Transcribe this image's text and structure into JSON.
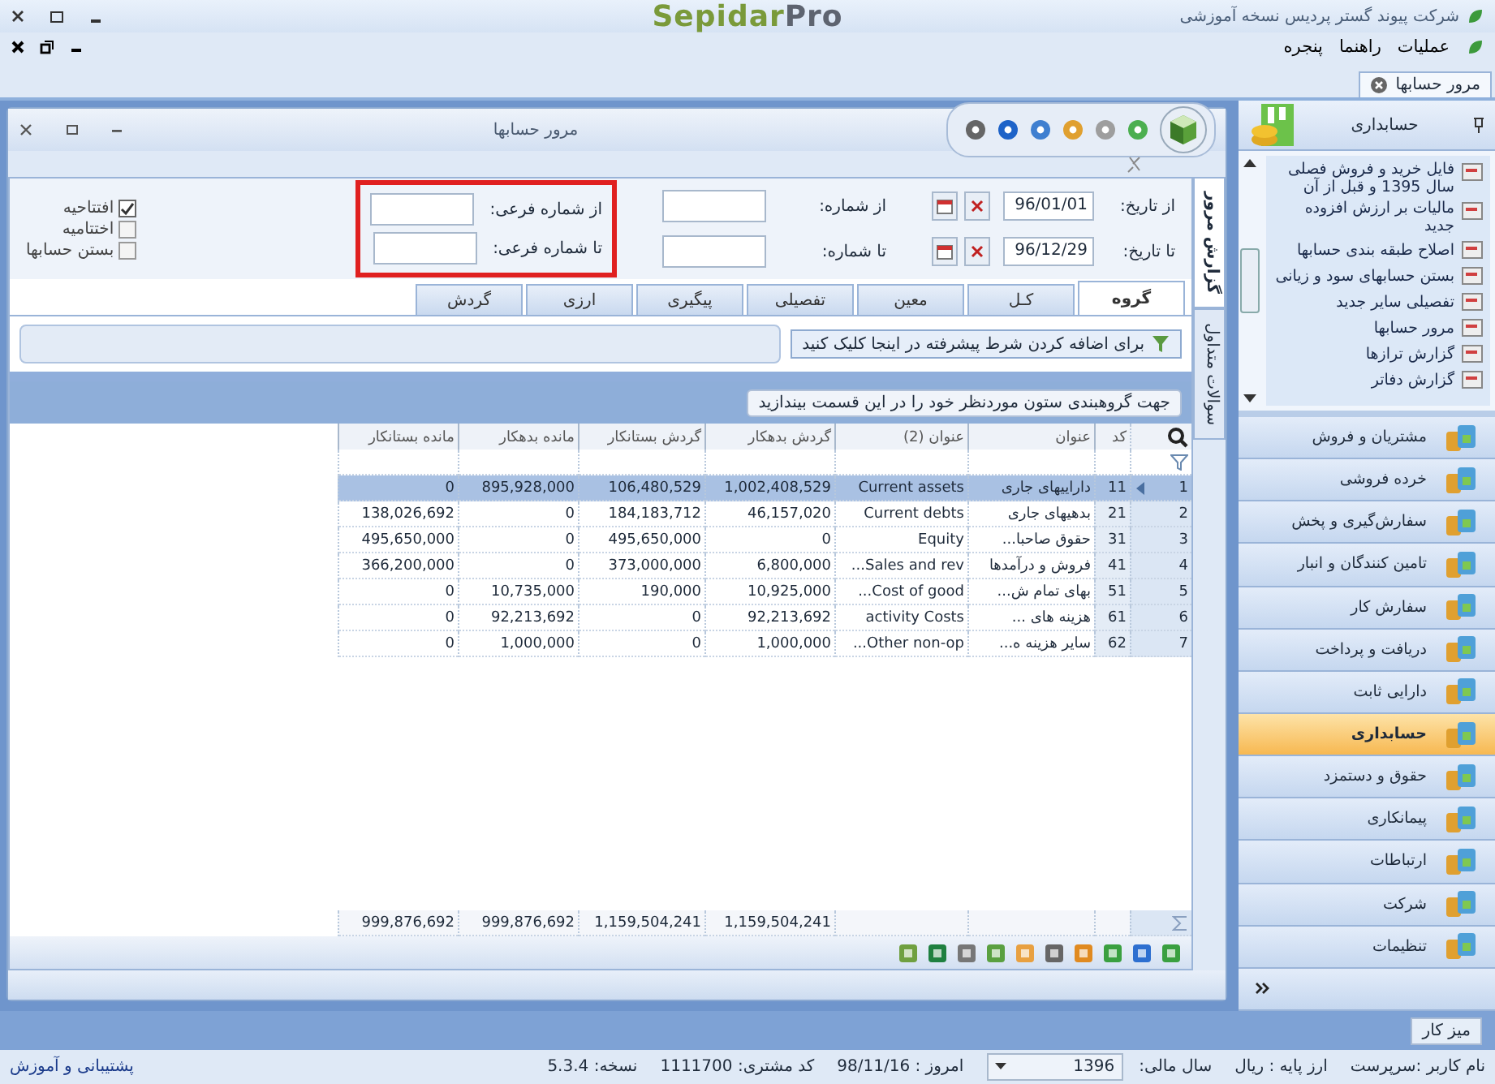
{
  "app_title": "شرکت پیوند گستر پردیس نسخه آموزشی",
  "logo": {
    "part1": "Sepidar",
    "part2": "Pro"
  },
  "menu": [
    "عملیات",
    "راهنما",
    "پنجره"
  ],
  "doc_tabs": [
    {
      "label": "مرور حسابها",
      "selected": true
    }
  ],
  "window": {
    "title": "مرور حسابها"
  },
  "side_tabs": [
    {
      "label": "گزارش مرور",
      "selected": true
    },
    {
      "label": "سوالات متداول",
      "selected": false
    }
  ],
  "filters": {
    "from_date_label": "از تاریخ:",
    "from_date": "96/01/01",
    "to_date_label": "تا تاریخ:",
    "to_date": "96/12/29",
    "from_number_label": "از شماره:",
    "to_number_label": "تا شماره:",
    "from_sub_label": "از شماره فرعی:",
    "to_sub_label": "تا شماره فرعی:"
  },
  "options": [
    {
      "label": "افتتاحیه",
      "checked": true
    },
    {
      "label": "اختتامیه",
      "checked": false
    },
    {
      "label": "بستن حسابها",
      "checked": false
    }
  ],
  "report_tabs": [
    {
      "label": "گروه",
      "selected": true
    },
    {
      "label": "کـل",
      "selected": false
    },
    {
      "label": "معین",
      "selected": false
    },
    {
      "label": "تفصیلی",
      "selected": false
    },
    {
      "label": "پیگیری",
      "selected": false
    },
    {
      "label": "ارزی",
      "selected": false
    },
    {
      "label": "گردش",
      "selected": false
    }
  ],
  "advanced_filter": "برای اضافه کردن شرط پیشرفته در اینجا کلیک کنید",
  "group_hint": "جهت گروهبندی ستون موردنظر خود را در این قسمت بیندازید",
  "table": {
    "columns": [
      "کد",
      "عنوان",
      "عنوان (2)",
      "گردش بدهکار",
      "گردش بستانکار",
      "مانده بدهکار",
      "مانده بستانکار"
    ],
    "rows": [
      {
        "num": "1",
        "selected": true,
        "cells": [
          "11",
          "داراییهای جاری",
          "Current assets",
          "1,002,408,529",
          "106,480,529",
          "895,928,000",
          "0"
        ]
      },
      {
        "num": "2",
        "selected": false,
        "cells": [
          "21",
          "بدهیهای جاری",
          "Current debts",
          "46,157,020",
          "184,183,712",
          "0",
          "138,026,692"
        ]
      },
      {
        "num": "3",
        "selected": false,
        "cells": [
          "31",
          "حقوق صاحبا...",
          "Equity",
          "0",
          "495,650,000",
          "0",
          "495,650,000"
        ]
      },
      {
        "num": "4",
        "selected": false,
        "cells": [
          "41",
          "فروش و درآمدها",
          "Sales and rev...",
          "6,800,000",
          "373,000,000",
          "0",
          "366,200,000"
        ]
      },
      {
        "num": "5",
        "selected": false,
        "cells": [
          "51",
          "بهای تمام ش...",
          "Cost of good...",
          "10,925,000",
          "190,000",
          "10,735,000",
          "0"
        ]
      },
      {
        "num": "6",
        "selected": false,
        "cells": [
          "61",
          "هزینه های ...",
          "activity Costs",
          "92,213,692",
          "0",
          "92,213,692",
          "0"
        ]
      },
      {
        "num": "7",
        "selected": false,
        "cells": [
          "62",
          "سایر هزینه ه...",
          "Other non-op...",
          "1,000,000",
          "0",
          "1,000,000",
          "0"
        ]
      }
    ],
    "totals": [
      "1,159,504,241",
      "1,159,504,241",
      "999,876,692",
      "999,876,692"
    ]
  },
  "sidebar": {
    "title": "حسابداری",
    "tasks": [
      "فایل خرید و فروش فصلی سال 1395 و قبل از آن",
      "مالیات بر ارزش افزوده جدید",
      "اصلاح طبقه بندی حسابها",
      "بستن حسابهای سود و زیانی",
      "تفصیلی سایر جدید",
      "مرور حسابها",
      "گزارش ترازها",
      "گزارش دفاتر"
    ],
    "modules": [
      {
        "label": "مشتریان و فروش",
        "selected": false
      },
      {
        "label": "خرده فروشی",
        "selected": false
      },
      {
        "label": "سفارش‌گیری و پخش",
        "selected": false
      },
      {
        "label": "تامین کنندگان و انبار",
        "selected": false
      },
      {
        "label": "سفارش کار",
        "selected": false
      },
      {
        "label": "دریافت و پرداخت",
        "selected": false
      },
      {
        "label": "دارایی ثابت",
        "selected": false
      },
      {
        "label": "حسابداری",
        "selected": true
      },
      {
        "label": "حقوق و دستمزد",
        "selected": false
      },
      {
        "label": "پیمانکاری",
        "selected": false
      },
      {
        "label": "ارتباطات",
        "selected": false
      },
      {
        "label": "شرکت",
        "selected": false
      },
      {
        "label": "تنظیمات",
        "selected": false
      }
    ]
  },
  "taskbar": [
    "میز کار"
  ],
  "status_bar": {
    "user": "نام کاربر :سرپرست",
    "currency": "ارز پایه : ریال",
    "year_label": "سال مالی:",
    "year": "1396",
    "today": "امروز : 98/11/16",
    "customer": "کد مشتری: 1111700",
    "version": "نسخه: 5.3.4",
    "support": "پشتیبانی و آموزش"
  }
}
